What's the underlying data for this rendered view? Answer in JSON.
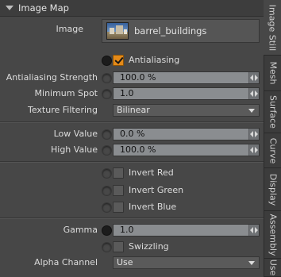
{
  "panel": {
    "title": "Image Map"
  },
  "image": {
    "label": "Image",
    "value": "barrel_buildings"
  },
  "antialiasing": {
    "label": "Antialiasing",
    "checked": true
  },
  "antialiasing_strength": {
    "label": "Antialiasing Strength",
    "value": "100.0 %"
  },
  "minimum_spot": {
    "label": "Minimum Spot",
    "value": "1.0"
  },
  "texture_filtering": {
    "label": "Texture Filtering",
    "value": "Bilinear"
  },
  "low_value": {
    "label": "Low Value",
    "value": "0.0 %"
  },
  "high_value": {
    "label": "High Value",
    "value": "100.0 %"
  },
  "invert_red": {
    "label": "Invert Red",
    "checked": false
  },
  "invert_green": {
    "label": "Invert Green",
    "checked": false
  },
  "invert_blue": {
    "label": "Invert Blue",
    "checked": false
  },
  "gamma": {
    "label": "Gamma",
    "value": "1.0"
  },
  "swizzling": {
    "label": "Swizzling",
    "checked": false
  },
  "alpha_channel": {
    "label": "Alpha Channel",
    "value": "Use"
  },
  "tabs": [
    "Image Still",
    "Mesh",
    "Surface",
    "Curve",
    "Display",
    "Assembly",
    "Use"
  ],
  "colors": {
    "accent": "#e48a19",
    "field": "#8a8d90",
    "background": "#474747"
  }
}
